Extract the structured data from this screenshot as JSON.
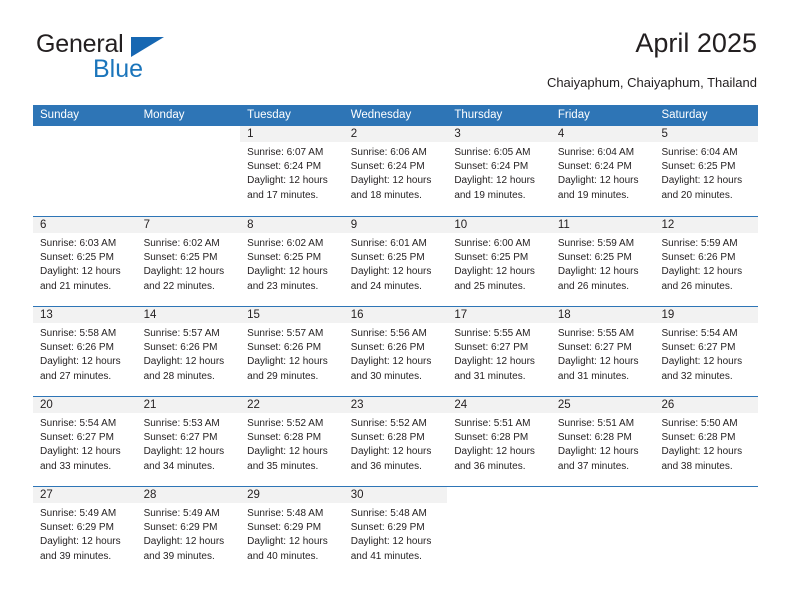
{
  "logo": {
    "word_top": "General",
    "word_bottom": "Blue",
    "triangle_color": "#1667b2",
    "blue_color": "#1b75bb"
  },
  "header": {
    "title": "April 2025",
    "subtitle": "Chaiyaphum, Chaiyaphum, Thailand"
  },
  "colors": {
    "header_bg": "#2e75b6",
    "daynum_band": "#f2f2f2",
    "grid_line": "#2e75b6",
    "text": "#231f20"
  },
  "weekday_headers": [
    "Sunday",
    "Monday",
    "Tuesday",
    "Wednesday",
    "Thursday",
    "Friday",
    "Saturday"
  ],
  "weeks": [
    [
      {
        "day": "",
        "sunrise": "",
        "sunset": "",
        "daylight_line1": "",
        "daylight_line2": "",
        "blank": true
      },
      {
        "day": "",
        "sunrise": "",
        "sunset": "",
        "daylight_line1": "",
        "daylight_line2": "",
        "blank": true
      },
      {
        "day": "1",
        "sunrise": "Sunrise: 6:07 AM",
        "sunset": "Sunset: 6:24 PM",
        "daylight_line1": "Daylight: 12 hours",
        "daylight_line2": "and 17 minutes."
      },
      {
        "day": "2",
        "sunrise": "Sunrise: 6:06 AM",
        "sunset": "Sunset: 6:24 PM",
        "daylight_line1": "Daylight: 12 hours",
        "daylight_line2": "and 18 minutes."
      },
      {
        "day": "3",
        "sunrise": "Sunrise: 6:05 AM",
        "sunset": "Sunset: 6:24 PM",
        "daylight_line1": "Daylight: 12 hours",
        "daylight_line2": "and 19 minutes."
      },
      {
        "day": "4",
        "sunrise": "Sunrise: 6:04 AM",
        "sunset": "Sunset: 6:24 PM",
        "daylight_line1": "Daylight: 12 hours",
        "daylight_line2": "and 19 minutes."
      },
      {
        "day": "5",
        "sunrise": "Sunrise: 6:04 AM",
        "sunset": "Sunset: 6:25 PM",
        "daylight_line1": "Daylight: 12 hours",
        "daylight_line2": "and 20 minutes."
      }
    ],
    [
      {
        "day": "6",
        "sunrise": "Sunrise: 6:03 AM",
        "sunset": "Sunset: 6:25 PM",
        "daylight_line1": "Daylight: 12 hours",
        "daylight_line2": "and 21 minutes."
      },
      {
        "day": "7",
        "sunrise": "Sunrise: 6:02 AM",
        "sunset": "Sunset: 6:25 PM",
        "daylight_line1": "Daylight: 12 hours",
        "daylight_line2": "and 22 minutes."
      },
      {
        "day": "8",
        "sunrise": "Sunrise: 6:02 AM",
        "sunset": "Sunset: 6:25 PM",
        "daylight_line1": "Daylight: 12 hours",
        "daylight_line2": "and 23 minutes."
      },
      {
        "day": "9",
        "sunrise": "Sunrise: 6:01 AM",
        "sunset": "Sunset: 6:25 PM",
        "daylight_line1": "Daylight: 12 hours",
        "daylight_line2": "and 24 minutes."
      },
      {
        "day": "10",
        "sunrise": "Sunrise: 6:00 AM",
        "sunset": "Sunset: 6:25 PM",
        "daylight_line1": "Daylight: 12 hours",
        "daylight_line2": "and 25 minutes."
      },
      {
        "day": "11",
        "sunrise": "Sunrise: 5:59 AM",
        "sunset": "Sunset: 6:25 PM",
        "daylight_line1": "Daylight: 12 hours",
        "daylight_line2": "and 26 minutes."
      },
      {
        "day": "12",
        "sunrise": "Sunrise: 5:59 AM",
        "sunset": "Sunset: 6:26 PM",
        "daylight_line1": "Daylight: 12 hours",
        "daylight_line2": "and 26 minutes."
      }
    ],
    [
      {
        "day": "13",
        "sunrise": "Sunrise: 5:58 AM",
        "sunset": "Sunset: 6:26 PM",
        "daylight_line1": "Daylight: 12 hours",
        "daylight_line2": "and 27 minutes."
      },
      {
        "day": "14",
        "sunrise": "Sunrise: 5:57 AM",
        "sunset": "Sunset: 6:26 PM",
        "daylight_line1": "Daylight: 12 hours",
        "daylight_line2": "and 28 minutes."
      },
      {
        "day": "15",
        "sunrise": "Sunrise: 5:57 AM",
        "sunset": "Sunset: 6:26 PM",
        "daylight_line1": "Daylight: 12 hours",
        "daylight_line2": "and 29 minutes."
      },
      {
        "day": "16",
        "sunrise": "Sunrise: 5:56 AM",
        "sunset": "Sunset: 6:26 PM",
        "daylight_line1": "Daylight: 12 hours",
        "daylight_line2": "and 30 minutes."
      },
      {
        "day": "17",
        "sunrise": "Sunrise: 5:55 AM",
        "sunset": "Sunset: 6:27 PM",
        "daylight_line1": "Daylight: 12 hours",
        "daylight_line2": "and 31 minutes."
      },
      {
        "day": "18",
        "sunrise": "Sunrise: 5:55 AM",
        "sunset": "Sunset: 6:27 PM",
        "daylight_line1": "Daylight: 12 hours",
        "daylight_line2": "and 31 minutes."
      },
      {
        "day": "19",
        "sunrise": "Sunrise: 5:54 AM",
        "sunset": "Sunset: 6:27 PM",
        "daylight_line1": "Daylight: 12 hours",
        "daylight_line2": "and 32 minutes."
      }
    ],
    [
      {
        "day": "20",
        "sunrise": "Sunrise: 5:54 AM",
        "sunset": "Sunset: 6:27 PM",
        "daylight_line1": "Daylight: 12 hours",
        "daylight_line2": "and 33 minutes."
      },
      {
        "day": "21",
        "sunrise": "Sunrise: 5:53 AM",
        "sunset": "Sunset: 6:27 PM",
        "daylight_line1": "Daylight: 12 hours",
        "daylight_line2": "and 34 minutes."
      },
      {
        "day": "22",
        "sunrise": "Sunrise: 5:52 AM",
        "sunset": "Sunset: 6:28 PM",
        "daylight_line1": "Daylight: 12 hours",
        "daylight_line2": "and 35 minutes."
      },
      {
        "day": "23",
        "sunrise": "Sunrise: 5:52 AM",
        "sunset": "Sunset: 6:28 PM",
        "daylight_line1": "Daylight: 12 hours",
        "daylight_line2": "and 36 minutes."
      },
      {
        "day": "24",
        "sunrise": "Sunrise: 5:51 AM",
        "sunset": "Sunset: 6:28 PM",
        "daylight_line1": "Daylight: 12 hours",
        "daylight_line2": "and 36 minutes."
      },
      {
        "day": "25",
        "sunrise": "Sunrise: 5:51 AM",
        "sunset": "Sunset: 6:28 PM",
        "daylight_line1": "Daylight: 12 hours",
        "daylight_line2": "and 37 minutes."
      },
      {
        "day": "26",
        "sunrise": "Sunrise: 5:50 AM",
        "sunset": "Sunset: 6:28 PM",
        "daylight_line1": "Daylight: 12 hours",
        "daylight_line2": "and 38 minutes."
      }
    ],
    [
      {
        "day": "27",
        "sunrise": "Sunrise: 5:49 AM",
        "sunset": "Sunset: 6:29 PM",
        "daylight_line1": "Daylight: 12 hours",
        "daylight_line2": "and 39 minutes."
      },
      {
        "day": "28",
        "sunrise": "Sunrise: 5:49 AM",
        "sunset": "Sunset: 6:29 PM",
        "daylight_line1": "Daylight: 12 hours",
        "daylight_line2": "and 39 minutes."
      },
      {
        "day": "29",
        "sunrise": "Sunrise: 5:48 AM",
        "sunset": "Sunset: 6:29 PM",
        "daylight_line1": "Daylight: 12 hours",
        "daylight_line2": "and 40 minutes."
      },
      {
        "day": "30",
        "sunrise": "Sunrise: 5:48 AM",
        "sunset": "Sunset: 6:29 PM",
        "daylight_line1": "Daylight: 12 hours",
        "daylight_line2": "and 41 minutes."
      },
      {
        "day": "",
        "sunrise": "",
        "sunset": "",
        "daylight_line1": "",
        "daylight_line2": "",
        "blank": true
      },
      {
        "day": "",
        "sunrise": "",
        "sunset": "",
        "daylight_line1": "",
        "daylight_line2": "",
        "blank": true
      },
      {
        "day": "",
        "sunrise": "",
        "sunset": "",
        "daylight_line1": "",
        "daylight_line2": "",
        "blank": true
      }
    ]
  ]
}
